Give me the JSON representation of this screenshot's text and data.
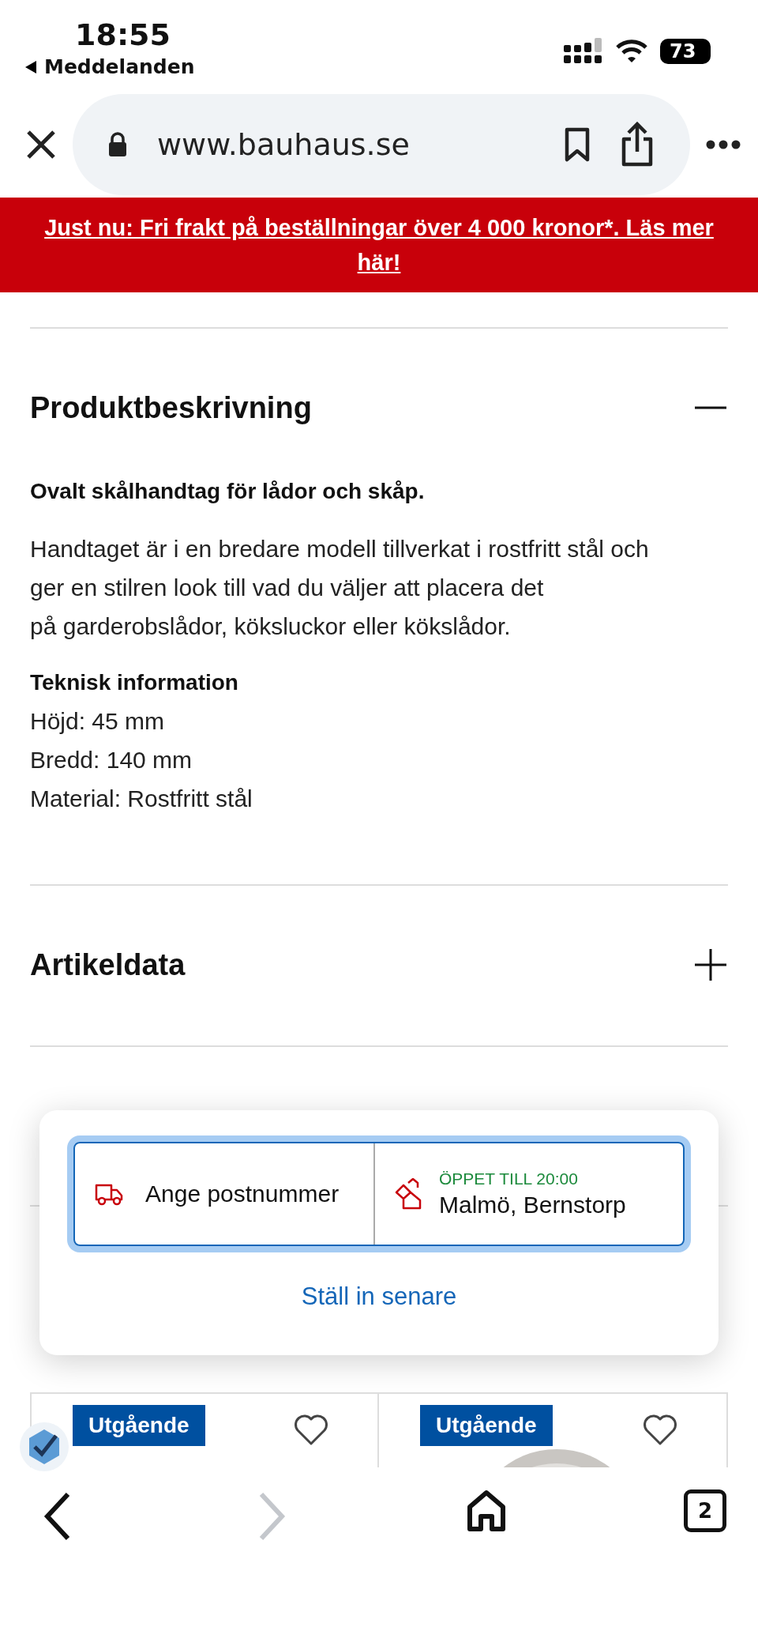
{
  "status_bar": {
    "time": "18:55",
    "back_label": "Meddelanden",
    "battery": "73"
  },
  "browser": {
    "url": "www.bauhaus.se"
  },
  "banner": {
    "text": "Just nu: Fri frakt på beställningar över 4 000 kronor*. Läs mer här!"
  },
  "sections": [
    {
      "title": "Produktbeskrivning",
      "expanded": true,
      "lead": "Ovalt skålhandtag för lådor och skåp.",
      "paragraph_lines": [
        "Handtaget är i en bredare modell tillverkat i rostfritt stål och",
        "ger en stilren look till vad du väljer att placera det",
        "på garderobslådor, köksluckor eller kökslådor."
      ],
      "specs_title": "Teknisk information",
      "specs": [
        "Höjd: 45 mm",
        "Bredd: 140 mm",
        "Material: Rostfritt stål"
      ]
    },
    {
      "title": "Artikeldata",
      "expanded": false
    }
  ],
  "store_popup": {
    "delivery_label": "Ange postnummer",
    "store_status": "ÖPPET TILL 20:00",
    "store_name": "Malmö, Bernstorp",
    "link": "Ställ in senare"
  },
  "products": [
    {
      "badge": "Utgående",
      "favorite": false,
      "kind": "blank"
    },
    {
      "badge": "Utgående",
      "favorite": false,
      "kind": "picture"
    }
  ],
  "toolbar": {
    "back_disabled": false,
    "forward_disabled": true,
    "tab_count": "2"
  }
}
